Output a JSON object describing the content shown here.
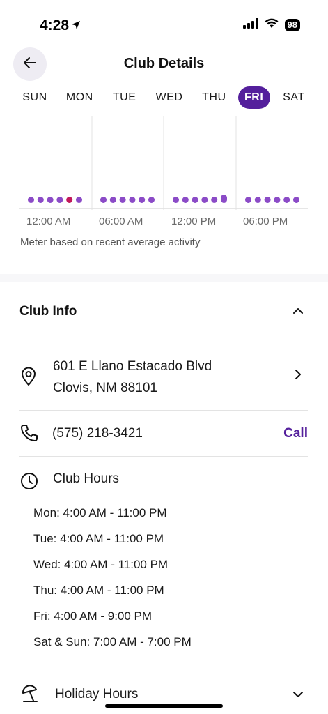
{
  "status_bar": {
    "time": "4:28",
    "battery": "98"
  },
  "header": {
    "title": "Club Details"
  },
  "days": [
    {
      "label": "SUN",
      "active": false
    },
    {
      "label": "MON",
      "active": false
    },
    {
      "label": "TUE",
      "active": false
    },
    {
      "label": "WED",
      "active": false
    },
    {
      "label": "THU",
      "active": false
    },
    {
      "label": "FRI",
      "active": true
    },
    {
      "label": "SAT",
      "active": false
    }
  ],
  "meter": {
    "time_labels": [
      "12:00 AM",
      "06:00 AM",
      "12:00 PM",
      "06:00 PM"
    ],
    "note": "Meter based on recent average activity",
    "current_hour_index": 4,
    "activity_levels": [
      0.05,
      0.05,
      0.05,
      0.05,
      0.05,
      0.08,
      0.05,
      0.05,
      0.08,
      0.06,
      0.05,
      0.05,
      0.05,
      0.05,
      0.05,
      0.05,
      0.05,
      0.15,
      0.05,
      0.05,
      0.05,
      0.05,
      0.05,
      0.05
    ],
    "colors": {
      "bar": "#8b4bc7",
      "current": "#c2185b"
    }
  },
  "club_info": {
    "title": "Club Info",
    "address_line1": "601 E Llano Estacado Blvd",
    "address_line2": "Clovis, NM 88101",
    "phone": "(575) 218-3421",
    "call_label": "Call",
    "hours_title": "Club Hours",
    "hours": [
      "Mon: 4:00 AM - 11:00 PM",
      "Tue: 4:00 AM - 11:00 PM",
      "Wed: 4:00 AM - 11:00 PM",
      "Thu: 4:00 AM - 11:00 PM",
      "Fri: 4:00 AM - 9:00 PM",
      "Sat & Sun: 7:00 AM - 7:00 PM"
    ],
    "holiday_hours_label": "Holiday Hours"
  },
  "colors": {
    "accent": "#541f9c",
    "back_button_bg": "#eeecf3"
  }
}
